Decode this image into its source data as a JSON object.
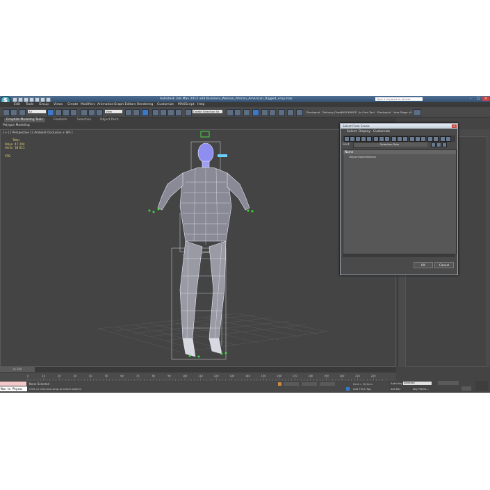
{
  "app": {
    "logo": "S",
    "title": "Autodesk 3ds Max 2012 x64      Business_Woman_African_American_Rigged_vray.max",
    "search_placeholder": "Type a keyword or phrase"
  },
  "menu": [
    "Edit",
    "Tools",
    "Group",
    "Views",
    "Create",
    "Modifiers",
    "Animation",
    "Graph Editors",
    "Rendering",
    "Customize",
    "MAXScript",
    "Help"
  ],
  "toolbar": {
    "filter": "All",
    "view": "View",
    "selection_set": "Create Selection Se",
    "right_items": [
      "Pixelsquid",
      "Delivery Check",
      "CHECKMATE",
      "Jiz Cam Tool",
      "Pixelsquid",
      "Vero Stage v5"
    ]
  },
  "ribbon": {
    "tabs": [
      "Graphite Modeling Tools",
      "Freeform",
      "Selection",
      "Object Paint"
    ],
    "sub": "Polygon Modeling"
  },
  "viewport": {
    "label": "[ + ] [ Perspective ] [ Ambient Occlusion + Wri ]",
    "stats_title": "Total",
    "polys_label": "Polys:",
    "polys": "47 204",
    "verts_label": "Verts:",
    "verts": "38 011",
    "fps": "FPS:"
  },
  "timeline": {
    "frame": "0 / 225",
    "ticks": [
      "0",
      "10",
      "20",
      "30",
      "40",
      "50",
      "60",
      "70",
      "80",
      "90",
      "100",
      "110",
      "120",
      "130",
      "140",
      "150",
      "160",
      "170",
      "180",
      "190",
      "200",
      "210",
      "220"
    ]
  },
  "status": {
    "maxscript": "Max to Physac",
    "selected": "None Selected",
    "prompt": "Click or click-and-drag to select objects",
    "grid": "Grid = 10,0cm",
    "auto_key": "Auto Key",
    "selected_dropdown": "Selected",
    "set_key": "Set Key",
    "key_filters": "Key Filters...",
    "add_time_tag": "Add Time Tag"
  },
  "dialog": {
    "title": "Select From Scene",
    "close": "x",
    "menu": [
      "Select",
      "Display",
      "Customize"
    ],
    "find_label": "Find:",
    "selection_sets": "Selection Sets",
    "column": "Name",
    "row": "HelperObjectWoman",
    "ok": "OK",
    "cancel": "Cancel"
  },
  "colors": {
    "viewport_bg": "#444444",
    "wire": "#e8e8ff",
    "helper_green": "#3fdc3f",
    "accent_blue": "#3c78c8"
  }
}
